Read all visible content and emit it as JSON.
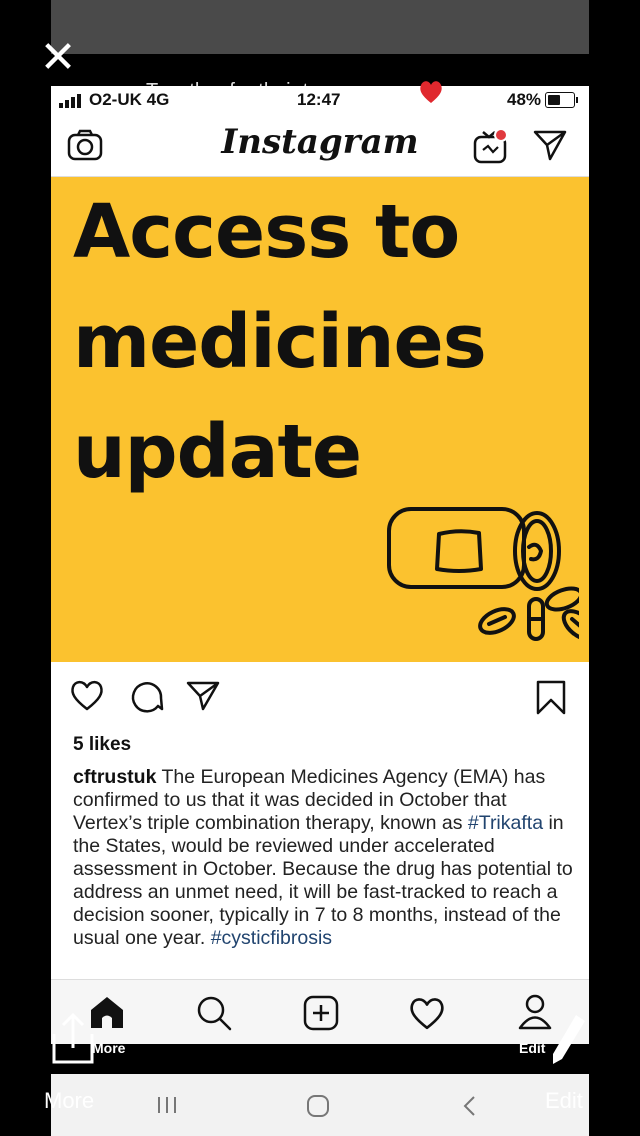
{
  "viewer": {
    "story_title": "Together for their tomorrows",
    "more_label": "More",
    "edit_label": "Edit"
  },
  "status_bar": {
    "carrier": "O2-UK 4G",
    "time": "12:47",
    "battery": "48%",
    "battery_level": 0.48
  },
  "instagram": {
    "logo": "Instagram",
    "post": {
      "image_text": [
        "Access to",
        "medicines",
        "update"
      ],
      "likes": "5 likes",
      "username": "cftrustuk",
      "caption_parts": [
        " The European Medicines Agency (EMA) has confirmed to us that it was decided in October that Vertex’s triple combination therapy, known as ",
        "#Trikafta",
        " in the States, would be reviewed under accelerated assessment in October. Because the drug has potential to address an unmet need, it will be fast-tracked to reach a decision sooner, typically in 7 to 8 months, instead of the usual one year. ",
        "#cysticfibrosis"
      ]
    },
    "nav": {
      "more": "More",
      "edit": "Edit"
    }
  },
  "icons": [
    "close-icon",
    "camera-icon",
    "igtv-icon",
    "direct-message-icon",
    "heart-icon",
    "comment-icon",
    "share-icon",
    "bookmark-icon",
    "home-icon",
    "search-icon",
    "add-icon",
    "profile-icon",
    "upload-icon",
    "pencil-icon"
  ],
  "colors": {
    "post_background": "#fbc22f",
    "hashtag": "#21446f",
    "igtv_dot": "#e0393e",
    "heart_emoji": "#e0282e"
  }
}
